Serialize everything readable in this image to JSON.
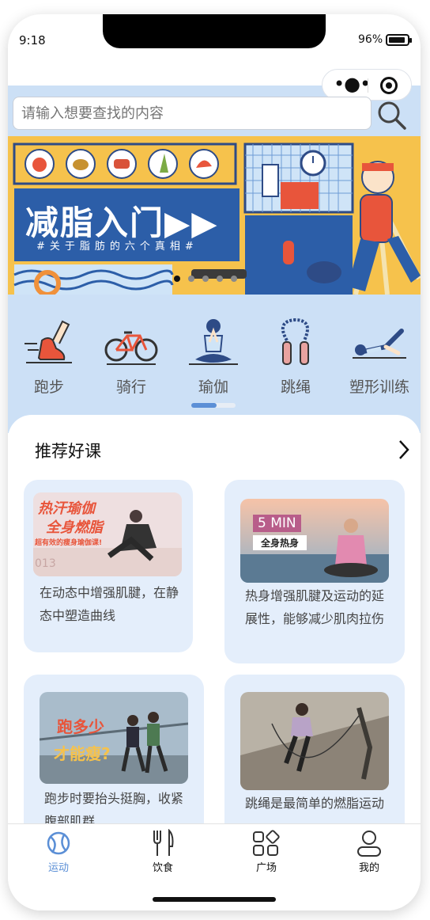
{
  "status_bar": {
    "time": "9:18",
    "battery": "96%"
  },
  "search": {
    "placeholder": "请输入想要查找的内容"
  },
  "banner": {
    "title": "减脂入门▶▶",
    "subtitle": "#关于脂肪的六个真相#"
  },
  "categories": [
    {
      "label": "跑步",
      "icon": "running-shoe-icon"
    },
    {
      "label": "骑行",
      "icon": "bicycle-icon"
    },
    {
      "label": "瑜伽",
      "icon": "yoga-icon"
    },
    {
      "label": "跳绳",
      "icon": "jump-rope-icon"
    },
    {
      "label": "塑形训练",
      "icon": "body-shaping-icon"
    }
  ],
  "recommend": {
    "title": "推荐好课",
    "courses": [
      {
        "desc": "在动态中增强肌腱，在静态中塑造曲线",
        "thumb_text": [
          "热汗瑜伽",
          "全身燃脂",
          "超有效的瘦身瑜伽课!",
          "013"
        ]
      },
      {
        "desc": "热身增强肌腱及运动的延展性，能够减少肌肉拉伤",
        "thumb_text": [
          "5 MIN",
          "全身热身"
        ]
      },
      {
        "desc": "跑步时要抬头挺胸，收紧腹部肌群",
        "thumb_text": [
          "跑多少",
          "才能瘦?"
        ]
      },
      {
        "desc": "跳绳是最简单的燃脂运动",
        "thumb_text": []
      }
    ]
  },
  "tabbar": [
    {
      "label": "运动",
      "icon": "sport-ball-icon",
      "active": true
    },
    {
      "label": "饮食",
      "icon": "fork-knife-icon",
      "active": false
    },
    {
      "label": "广场",
      "icon": "grid-square-icon",
      "active": false
    },
    {
      "label": "我的",
      "icon": "user-icon",
      "active": false
    }
  ],
  "colors": {
    "accent": "#5b8fd6",
    "band": "#cce0f6",
    "card": "#e4eefb"
  }
}
